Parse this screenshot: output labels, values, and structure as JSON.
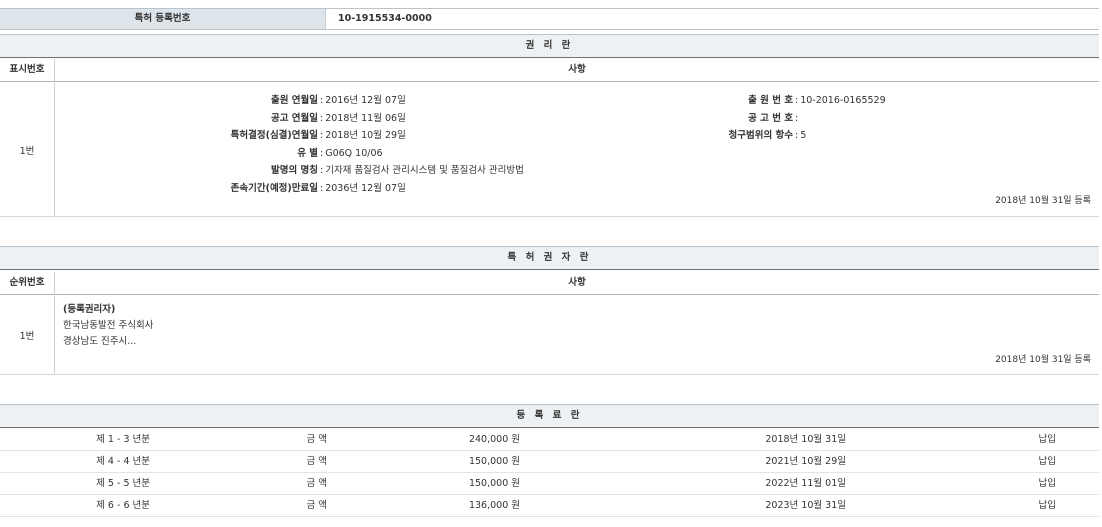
{
  "registration": {
    "label": "특허 등록번호",
    "value": "10-1915534-0000"
  },
  "rights": {
    "heading": "권 리 란",
    "col_no": "표시번호",
    "col_item": "사항",
    "row_no": "1번",
    "left": [
      {
        "k": "출원 연월일",
        "v": "2016년 12월 07일"
      },
      {
        "k": "공고 연월일",
        "v": "2018년 11월 06일"
      },
      {
        "k": "특허결정(심결)연월일",
        "v": "2018년 10월 29일"
      },
      {
        "k": "유 별",
        "v": "G06Q 10/06"
      },
      {
        "k": "발명의 명칭",
        "v": "기자재 품질검사 관리시스템 및 품질검사 관리방법"
      },
      {
        "k": "존속기간(예정)만료일",
        "v": "2036년 12월 07일"
      }
    ],
    "right": [
      {
        "k": "출 원 번 호",
        "v": "10-2016-0165529"
      },
      {
        "k": "공 고 번 호",
        "v": ""
      },
      {
        "k": "청구범위의 항수",
        "v": "5"
      }
    ],
    "reg_date": "2018년 10월 31일 등록"
  },
  "holders": {
    "heading": "특 허 권 자 란",
    "col_no": "순위번호",
    "col_item": "사항",
    "row_no": "1번",
    "title": "(등록권리자)",
    "name": "한국남동발전 주식회사",
    "address": "경상남도 진주시...",
    "reg_date": "2018년 10월 31일 등록"
  },
  "fees": {
    "heading": "등 록 료 란",
    "rows": [
      {
        "period": "제 1 - 3 년분",
        "label": "금 액",
        "amount": "240,000 원",
        "date": "2018년 10월 31일",
        "status": "납입"
      },
      {
        "period": "제 4 - 4 년분",
        "label": "금 액",
        "amount": "150,000 원",
        "date": "2021년 10월 29일",
        "status": "납입"
      },
      {
        "period": "제 5 - 5 년분",
        "label": "금 액",
        "amount": "150,000 원",
        "date": "2022년 11월 01일",
        "status": "납입"
      },
      {
        "period": "제 6 - 6 년분",
        "label": "금 액",
        "amount": "136,000 원",
        "date": "2023년 10월 31일",
        "status": "납입"
      }
    ]
  }
}
